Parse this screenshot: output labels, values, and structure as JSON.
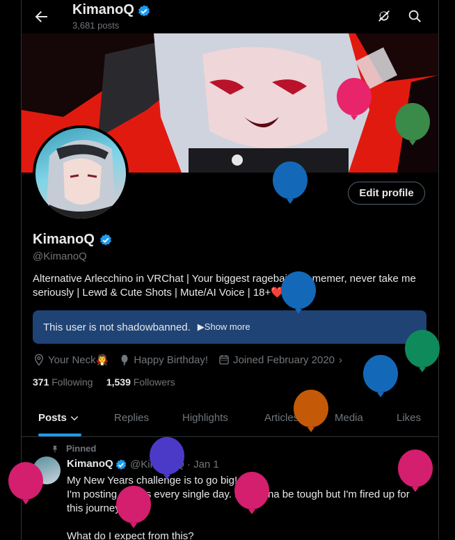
{
  "header": {
    "title": "KimanoQ",
    "post_count": "3,681 posts"
  },
  "profile": {
    "name": "KimanoQ",
    "handle": "@KimanoQ",
    "bio": "Alternative Arlecchino in VRChat | Your biggest ragebaiter & memer, never take me seriously | Lewd & Cute Shots | Mute/AI Voice | 18+",
    "bio_emoji": "❤️",
    "edit_button": "Edit profile",
    "notice": "This user is not shadowbanned.",
    "notice_more": "Show more",
    "location": "Your Neck",
    "location_emoji": "🧛",
    "birthday": "Happy Birthday!",
    "joined": "Joined February 2020",
    "following_count": "371",
    "following_label": "Following",
    "followers_count": "1,539",
    "followers_label": "Followers"
  },
  "tabs": [
    {
      "label": "Posts"
    },
    {
      "label": "Replies"
    },
    {
      "label": "Highlights"
    },
    {
      "label": "Articles"
    },
    {
      "label": "Media"
    },
    {
      "label": "Likes"
    }
  ],
  "post": {
    "pinned_label": "Pinned",
    "author": "KimanoQ",
    "handle_time": "@KimanoQ · Jan 1",
    "lines": [
      "My New Years challenge is to go big!",
      "I'm posting photos every single day. It's gonna be tough but I'm fired up for this journey.",
      "",
      "What do I expect from this?"
    ]
  },
  "colors": {
    "accent": "#1d9bf0",
    "notice_bg": "#1f4374",
    "banner_red": "#e11a10"
  },
  "icons": [
    "back-arrow-icon",
    "refresh-icon",
    "search-icon",
    "verified-icon",
    "location-icon",
    "balloon-icon",
    "calendar-icon",
    "pin-icon",
    "more-icon"
  ]
}
